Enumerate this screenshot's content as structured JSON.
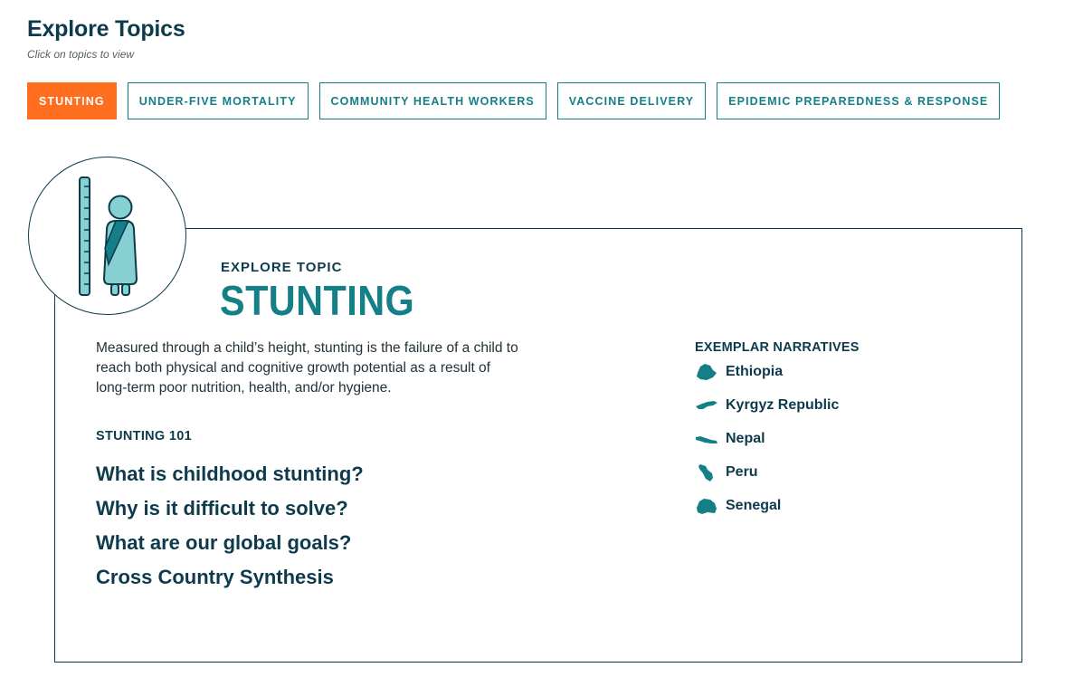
{
  "header": {
    "title": "Explore Topics",
    "subtitle": "Click on topics to view"
  },
  "tabs": [
    {
      "label": "STUNTING",
      "active": true
    },
    {
      "label": "UNDER-FIVE MORTALITY",
      "active": false
    },
    {
      "label": "COMMUNITY HEALTH WORKERS",
      "active": false
    },
    {
      "label": "VACCINE DELIVERY",
      "active": false
    },
    {
      "label": "EPIDEMIC PREPAREDNESS & RESPONSE",
      "active": false
    }
  ],
  "topic": {
    "eyebrow": "EXPLORE TOPIC",
    "title": "STUNTING",
    "description": "Measured through a child’s height, stunting is the failure of a child to reach both physical and cognitive growth potential as a result of long-term poor nutrition, health, and/or hygiene.",
    "icon": "child-height-measure-icon",
    "section_label": "STUNTING 101",
    "links": [
      "What is childhood stunting?",
      "Why is it difficult to solve?",
      "What are our global goals?",
      "Cross Country Synthesis"
    ]
  },
  "narratives": {
    "label": "EXEMPLAR NARRATIVES",
    "countries": [
      {
        "name": "Ethiopia",
        "icon": "ethiopia-map-icon"
      },
      {
        "name": "Kyrgyz Republic",
        "icon": "kyrgyz-republic-map-icon"
      },
      {
        "name": "Nepal",
        "icon": "nepal-map-icon"
      },
      {
        "name": "Peru",
        "icon": "peru-map-icon"
      },
      {
        "name": "Senegal",
        "icon": "senegal-map-icon"
      }
    ]
  },
  "colors": {
    "primary": "#0d3b4c",
    "teal": "#157f87",
    "active_tab": "#ff6d1f",
    "icon_fill": "#86cfd2"
  }
}
